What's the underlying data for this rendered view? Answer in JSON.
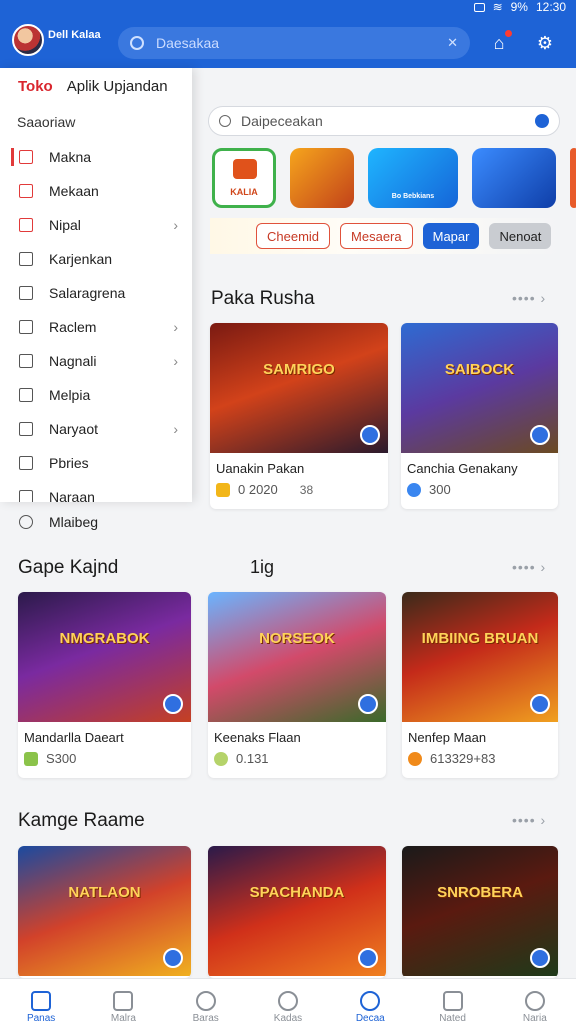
{
  "status": {
    "battery": "9%",
    "time": "12:30"
  },
  "header": {
    "brand": "Dell Kalaa",
    "search_placeholder": "Daesakaa",
    "clear_symbol": "✕",
    "colors": {
      "bar": "#1e63d6",
      "accent_red": "#d9262e"
    }
  },
  "drawer": {
    "title_red": "Toko",
    "title": "Aplik Upjandan",
    "section": "Saaoriaw",
    "items": [
      {
        "label": "Makna",
        "icon": "bookmark-icon"
      },
      {
        "label": "Mekaan",
        "icon": "home-icon"
      },
      {
        "label": "Nipal",
        "icon": "puzzle-icon"
      },
      {
        "label": "Karjenkan",
        "icon": "grid-icon"
      },
      {
        "label": "Salaragrena",
        "icon": "frame-icon"
      },
      {
        "label": "Raclem",
        "icon": "tag-icon"
      },
      {
        "label": "Nagnali",
        "icon": "leaf-icon"
      },
      {
        "label": "Melpia",
        "icon": "heart-icon"
      },
      {
        "label": "Naryaot",
        "icon": "list-icon"
      },
      {
        "label": "Pbries",
        "icon": "shop-icon"
      },
      {
        "label": "Naraan",
        "icon": "clock-icon"
      }
    ],
    "below_item": "Mlaibeg"
  },
  "main": {
    "search_placeholder": "Daipeceakan",
    "apps": [
      {
        "label": "KALIA",
        "icon": "game-app-icon"
      },
      {
        "label": "",
        "icon": "hero-app-icon"
      },
      {
        "label": "Bo Bebkians",
        "icon": "blocks-app-icon"
      },
      {
        "label": "",
        "icon": "racing-app-icon"
      }
    ],
    "chips": [
      "Cheemid",
      "Mesaera",
      "Mapar",
      "Nenoat"
    ],
    "section1": {
      "title": "Paka Rusha",
      "more": "•••• ›"
    },
    "section2": {
      "title": "Gape Kajnd",
      "subtitle": "1ig",
      "more": "•••• ›"
    },
    "section3": {
      "title": "Kamge Raame",
      "more": "•••• ›"
    },
    "cards": [
      {
        "art": "SAMRIGO",
        "name": "Uanakin Pakan",
        "meta": "0 2020",
        "extra": "38"
      },
      {
        "art": "SAIBOCK",
        "name": "Canchia Genakany",
        "meta": "300",
        "extra": ""
      },
      {
        "art": "NMGRABOK",
        "name": "Mandarlla Daeart",
        "meta": "S300",
        "extra": ""
      },
      {
        "art": "NORSEOK",
        "name": "Keenaks Flaan",
        "meta": "0.131",
        "extra": ""
      },
      {
        "art": "IMBIING BRUAN",
        "name": "Nenfep Maan",
        "meta": "613329+83",
        "extra": ""
      },
      {
        "art": "NATLAON",
        "name": "",
        "meta": "",
        "extra": ""
      },
      {
        "art": "SPACHANDA",
        "name": "",
        "meta": "",
        "extra": ""
      },
      {
        "art": "SNROBERA",
        "name": "",
        "meta": "",
        "extra": ""
      }
    ]
  },
  "bottomnav": [
    "Panas",
    "Malra",
    "Baras",
    "Kadas",
    "Decaa",
    "Nated",
    "Naria"
  ]
}
